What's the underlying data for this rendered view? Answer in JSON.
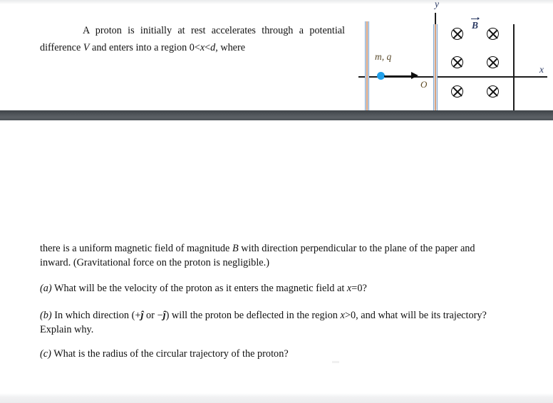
{
  "document": {
    "intro": {
      "text": "A proton is initially at rest accelerates through a potential difference V and enters into a region 0<x<d, where",
      "line1": "A proton is initially at rest accelerates through a",
      "line2_pre": "potential difference ",
      "line2_italic": "V",
      "line2_post": " and enters into a region 0<",
      "line2_x": "x",
      "line2_tail": "<",
      "line2_d": "d",
      "line2_end": ", where"
    },
    "description": {
      "pre": "there is a uniform magnetic field of magnitude ",
      "symbol": "B",
      "post": " with direction perpendicular to the plane of the paper and inward. (Gravitational force on the proton is negligible.)"
    },
    "questions": [
      {
        "marker": "(a)",
        "text_pre": " What will be the velocity of the proton as it enters the magnetic field at ",
        "math": "x",
        "text_post": "=0?"
      },
      {
        "marker": "(b)",
        "text_pre": " In which direction (+",
        "jhat1": "ĵ",
        "text_mid": " or −",
        "jhat2": "ĵ",
        "text_post": ") will the proton be deflected in the region ",
        "math": "x",
        "text_end": ">0, and what will be its trajectory? Explain why."
      },
      {
        "marker": "(c)",
        "text_pre": " What is the radius of the circular trajectory of the proton?",
        "math": "",
        "text_post": ""
      }
    ]
  },
  "figure": {
    "axis_labels": {
      "y": "y",
      "x": "x",
      "origin": "O",
      "field": "B",
      "particle": "m, q"
    },
    "field_symbol": "⊗",
    "field_crosses_count": 6,
    "field_rows": 3,
    "field_columns": 2,
    "colors": {
      "particle": "#22a0ea",
      "plate_blue": "#7fa6cf",
      "plate_core": "#d8a27e",
      "axis": "#1d1d1d",
      "label_blue": "#2b3a63",
      "label_brown": "#5a4a2b",
      "divider_band": "#4a4f54"
    }
  }
}
